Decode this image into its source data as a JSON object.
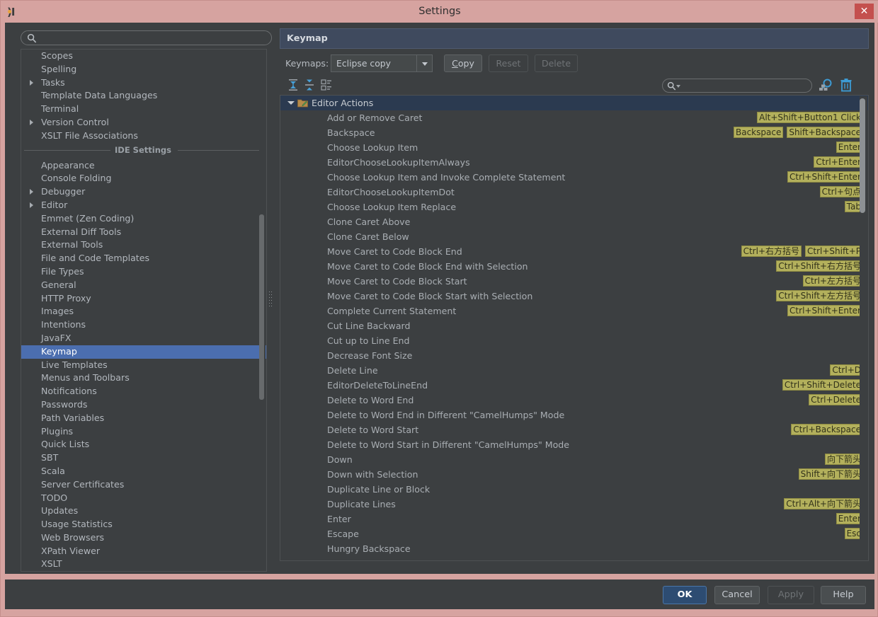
{
  "window": {
    "title": "Settings",
    "app_icon": "intellij-idea-icon",
    "close_label": "✕",
    "titlebar_color": "#d6a3a0",
    "close_button_color": "#c4504e"
  },
  "sidebar": {
    "search": {
      "placeholder": "",
      "value": "",
      "icon": "search-icon"
    },
    "items": [
      {
        "label": "Scopes",
        "expandable": false,
        "selected": false
      },
      {
        "label": "Spelling",
        "expandable": false,
        "selected": false
      },
      {
        "label": "Tasks",
        "expandable": true,
        "selected": false
      },
      {
        "label": "Template Data Languages",
        "expandable": false,
        "selected": false
      },
      {
        "label": "Terminal",
        "expandable": false,
        "selected": false
      },
      {
        "label": "Version Control",
        "expandable": true,
        "selected": false
      },
      {
        "label": "XSLT File Associations",
        "expandable": false,
        "selected": false
      }
    ],
    "separator_label": "IDE Settings",
    "items2": [
      {
        "label": "Appearance",
        "expandable": false,
        "selected": false
      },
      {
        "label": "Console Folding",
        "expandable": false,
        "selected": false
      },
      {
        "label": "Debugger",
        "expandable": true,
        "selected": false
      },
      {
        "label": "Editor",
        "expandable": true,
        "selected": false
      },
      {
        "label": "Emmet (Zen Coding)",
        "expandable": false,
        "selected": false
      },
      {
        "label": "External Diff Tools",
        "expandable": false,
        "selected": false
      },
      {
        "label": "External Tools",
        "expandable": false,
        "selected": false
      },
      {
        "label": "File and Code Templates",
        "expandable": false,
        "selected": false
      },
      {
        "label": "File Types",
        "expandable": false,
        "selected": false
      },
      {
        "label": "General",
        "expandable": false,
        "selected": false
      },
      {
        "label": "HTTP Proxy",
        "expandable": false,
        "selected": false
      },
      {
        "label": "Images",
        "expandable": false,
        "selected": false
      },
      {
        "label": "Intentions",
        "expandable": false,
        "selected": false
      },
      {
        "label": "JavaFX",
        "expandable": false,
        "selected": false
      },
      {
        "label": "Keymap",
        "expandable": false,
        "selected": true
      },
      {
        "label": "Live Templates",
        "expandable": false,
        "selected": false
      },
      {
        "label": "Menus and Toolbars",
        "expandable": false,
        "selected": false
      },
      {
        "label": "Notifications",
        "expandable": false,
        "selected": false
      },
      {
        "label": "Passwords",
        "expandable": false,
        "selected": false
      },
      {
        "label": "Path Variables",
        "expandable": false,
        "selected": false
      },
      {
        "label": "Plugins",
        "expandable": false,
        "selected": false
      },
      {
        "label": "Quick Lists",
        "expandable": false,
        "selected": false
      },
      {
        "label": "SBT",
        "expandable": false,
        "selected": false
      },
      {
        "label": "Scala",
        "expandable": false,
        "selected": false
      },
      {
        "label": "Server Certificates",
        "expandable": false,
        "selected": false
      },
      {
        "label": "TODO",
        "expandable": false,
        "selected": false
      },
      {
        "label": "Updates",
        "expandable": false,
        "selected": false
      },
      {
        "label": "Usage Statistics",
        "expandable": false,
        "selected": false
      },
      {
        "label": "Web Browsers",
        "expandable": false,
        "selected": false
      },
      {
        "label": "XPath Viewer",
        "expandable": false,
        "selected": false
      },
      {
        "label": "XSLT",
        "expandable": false,
        "selected": false
      }
    ],
    "selected_color": "#4b6eaf"
  },
  "panel": {
    "title": "Keymap",
    "header_color": "#3f4a5e",
    "keymaps_label": "Keymaps:",
    "keymap_selected": "Eclipse copy",
    "buttons": [
      {
        "label": "Copy",
        "mnemonic": "C",
        "enabled": true
      },
      {
        "label": "Reset",
        "enabled": false
      },
      {
        "label": "Delete",
        "enabled": false
      }
    ],
    "toolbar_icons": [
      {
        "name": "expand-all-icon"
      },
      {
        "name": "collapse-all-icon"
      },
      {
        "name": "show-tree-icon"
      }
    ],
    "shortcut_search": {
      "placeholder": "",
      "value": "",
      "icon": "search-icon"
    },
    "find_shortcut_icon": "find-by-shortcut-icon",
    "clear_shortcut_icon": "delete-trash-icon"
  },
  "tree": {
    "group": {
      "label": "Editor Actions",
      "expanded": true,
      "icon": "editor-actions-folder-icon",
      "selected": true,
      "selected_color": "#2b3a50"
    },
    "badge_color": "#b3b05c",
    "rows": [
      {
        "label": "Add or Remove Caret",
        "shortcuts": [
          "Alt+Shift+Button1 Click"
        ]
      },
      {
        "label": "Backspace",
        "shortcuts": [
          "Backspace",
          "Shift+Backspace"
        ]
      },
      {
        "label": "Choose Lookup Item",
        "shortcuts": [
          "Enter"
        ]
      },
      {
        "label": "EditorChooseLookupItemAlways",
        "shortcuts": [
          "Ctrl+Enter"
        ]
      },
      {
        "label": "Choose Lookup Item and Invoke Complete Statement",
        "shortcuts": [
          "Ctrl+Shift+Enter"
        ]
      },
      {
        "label": "EditorChooseLookupItemDot",
        "shortcuts": [
          "Ctrl+句点"
        ]
      },
      {
        "label": "Choose Lookup Item Replace",
        "shortcuts": [
          "Tab"
        ]
      },
      {
        "label": "Clone Caret Above",
        "shortcuts": []
      },
      {
        "label": "Clone Caret Below",
        "shortcuts": []
      },
      {
        "label": "Move Caret to Code Block End",
        "shortcuts": [
          "Ctrl+右方括号",
          "Ctrl+Shift+P"
        ]
      },
      {
        "label": "Move Caret to Code Block End with Selection",
        "shortcuts": [
          "Ctrl+Shift+右方括号"
        ]
      },
      {
        "label": "Move Caret to Code Block Start",
        "shortcuts": [
          "Ctrl+左方括号"
        ]
      },
      {
        "label": "Move Caret to Code Block Start with Selection",
        "shortcuts": [
          "Ctrl+Shift+左方括号"
        ]
      },
      {
        "label": "Complete Current Statement",
        "shortcuts": [
          "Ctrl+Shift+Enter"
        ]
      },
      {
        "label": "Cut Line Backward",
        "shortcuts": []
      },
      {
        "label": "Cut up to Line End",
        "shortcuts": []
      },
      {
        "label": "Decrease Font Size",
        "shortcuts": []
      },
      {
        "label": "Delete Line",
        "shortcuts": [
          "Ctrl+D"
        ]
      },
      {
        "label": "EditorDeleteToLineEnd",
        "shortcuts": [
          "Ctrl+Shift+Delete"
        ]
      },
      {
        "label": "Delete to Word End",
        "shortcuts": [
          "Ctrl+Delete"
        ]
      },
      {
        "label": "Delete to Word End in Different \"CamelHumps\" Mode",
        "shortcuts": []
      },
      {
        "label": "Delete to Word Start",
        "shortcuts": [
          "Ctrl+Backspace"
        ]
      },
      {
        "label": "Delete to Word Start in Different \"CamelHumps\" Mode",
        "shortcuts": []
      },
      {
        "label": "Down",
        "shortcuts": [
          "向下箭头"
        ]
      },
      {
        "label": "Down with Selection",
        "shortcuts": [
          "Shift+向下箭头"
        ]
      },
      {
        "label": "Duplicate Line or Block",
        "shortcuts": []
      },
      {
        "label": "Duplicate Lines",
        "shortcuts": [
          "Ctrl+Alt+向下箭头"
        ]
      },
      {
        "label": "Enter",
        "shortcuts": [
          "Enter"
        ]
      },
      {
        "label": "Escape",
        "shortcuts": [
          "Esc"
        ]
      },
      {
        "label": "Hungry Backspace",
        "shortcuts": []
      }
    ]
  },
  "footer": {
    "buttons": [
      {
        "label": "OK",
        "style": "default"
      },
      {
        "label": "Cancel",
        "style": "normal"
      },
      {
        "label": "Apply",
        "style": "disabled"
      },
      {
        "label": "Help",
        "style": "normal"
      }
    ]
  }
}
